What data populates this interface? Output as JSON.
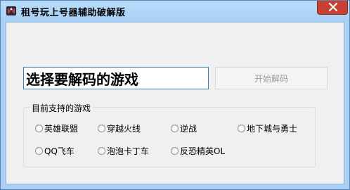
{
  "window": {
    "title": "租号玩上号器辅助破解版",
    "icon": "app-icon",
    "close_icon": "close-icon"
  },
  "main": {
    "game_input": {
      "value": "选择要解码的游戏"
    },
    "start_button": {
      "label": "开始解码",
      "enabled": false
    }
  },
  "supported_games": {
    "label": "目前支持的游戏",
    "options": [
      {
        "label": "英雄联盟",
        "selected": false
      },
      {
        "label": "穿越火线",
        "selected": false
      },
      {
        "label": "逆战",
        "selected": false
      },
      {
        "label": "地下城与勇士",
        "selected": false
      },
      {
        "label": "QQ飞车",
        "selected": false
      },
      {
        "label": "泡泡卡丁车",
        "selected": false
      },
      {
        "label": "反恐精英OL",
        "selected": false
      }
    ]
  },
  "colors": {
    "title_bar": "#aad1f5",
    "close_button": "#c84034",
    "client_background": "#f0f0f0",
    "input_border": "#3c7fb1"
  }
}
